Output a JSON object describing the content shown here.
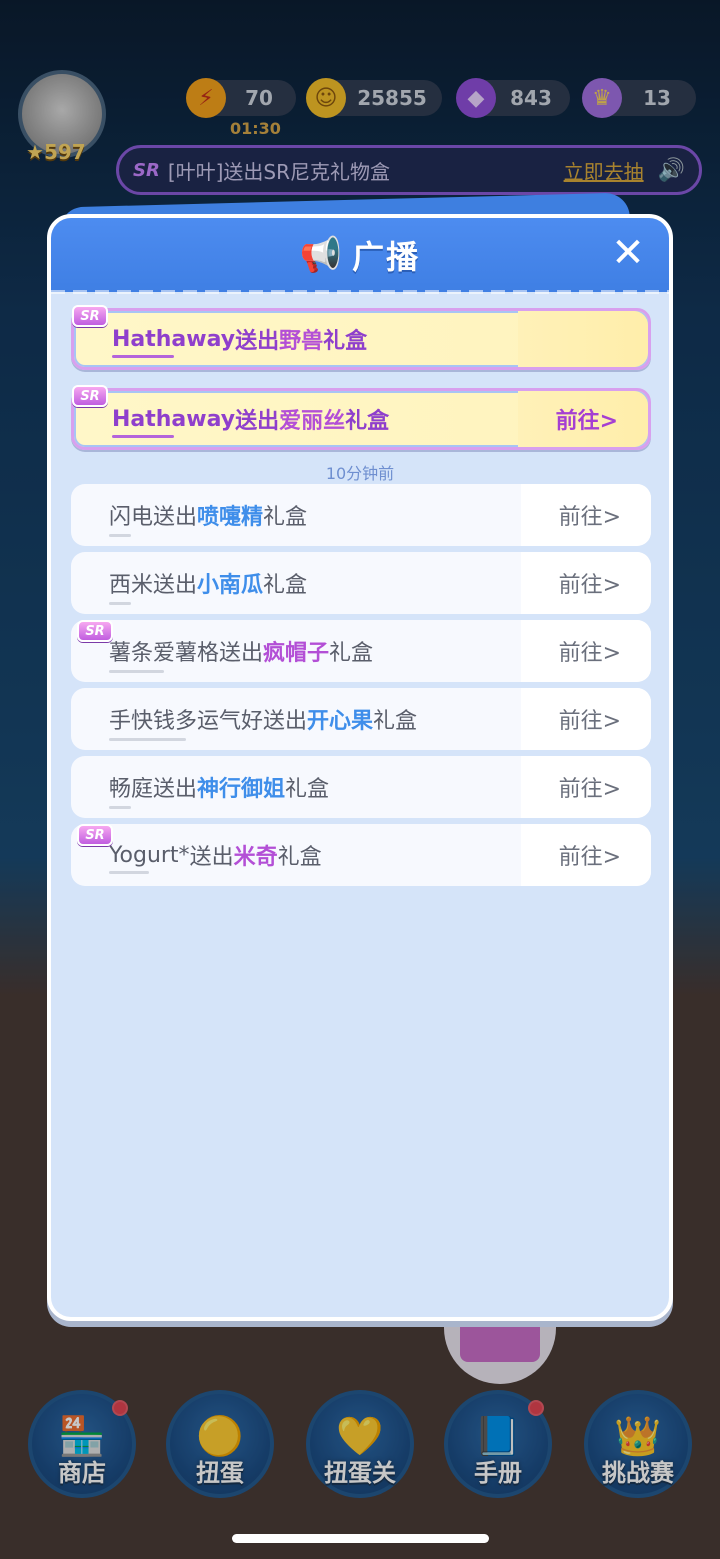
{
  "hud": {
    "level": "597",
    "energy": "70",
    "energy_timer": "01:30",
    "coins": "25855",
    "gems": "843",
    "crowns": "13"
  },
  "top_banner": {
    "sr_tag": "SR",
    "text": "[叶叶]送出SR尼克礼物盒",
    "link": "立即去抽",
    "speaker_icon": "speaker-icon"
  },
  "modal": {
    "title": "广播",
    "icon": "megaphone-icon",
    "close_icon": "close-icon",
    "time_label": "10分钟前",
    "items": [
      {
        "sr": true,
        "badge": "SR",
        "sender": "Hathaway",
        "mid": "送出",
        "gift": "野兽",
        "suffix": "礼盒",
        "goto": "",
        "gift_color": "purple"
      },
      {
        "sr": true,
        "badge": "SR",
        "sender": "Hathaway",
        "mid": "送出",
        "gift": "爱丽丝",
        "suffix": "礼盒",
        "goto": "前往>",
        "gift_color": "purple"
      },
      {
        "sr": false,
        "badge": "",
        "sender": "闪电",
        "mid": "送出",
        "gift": "喷嚏精",
        "suffix": "礼盒",
        "goto": "前往>",
        "gift_color": "blue"
      },
      {
        "sr": false,
        "badge": "",
        "sender": "西米",
        "mid": "送出",
        "gift": "小南瓜",
        "suffix": "礼盒",
        "goto": "前往>",
        "gift_color": "blue"
      },
      {
        "sr": false,
        "badge": "SR",
        "sender": "薯条爱薯格",
        "mid": "送出",
        "gift": "疯帽子",
        "suffix": "礼盒",
        "goto": "前往>",
        "gift_color": "purple"
      },
      {
        "sr": false,
        "badge": "",
        "sender": "手快钱多运气好",
        "mid": "送出",
        "gift": "开心果",
        "suffix": "礼盒",
        "goto": "前往>",
        "gift_color": "blue"
      },
      {
        "sr": false,
        "badge": "",
        "sender": "畅庭",
        "mid": "送出",
        "gift": "神行御姐",
        "suffix": "礼盒",
        "goto": "前往>",
        "gift_color": "blue"
      },
      {
        "sr": false,
        "badge": "SR",
        "sender": "Yogurt*",
        "mid": "送出",
        "gift": "米奇",
        "suffix": "礼盒",
        "goto": "前往>",
        "gift_color": "purple"
      }
    ]
  },
  "bottom_nav": [
    {
      "label": "商店",
      "icon": "shop-icon",
      "dot": true
    },
    {
      "label": "扭蛋",
      "icon": "capsule-icon",
      "dot": false
    },
    {
      "label": "扭蛋关",
      "icon": "capsule-level-icon",
      "dot": false
    },
    {
      "label": "手册",
      "icon": "handbook-icon",
      "dot": true
    },
    {
      "label": "挑战赛",
      "icon": "crown-challenge-icon",
      "dot": false
    }
  ]
}
